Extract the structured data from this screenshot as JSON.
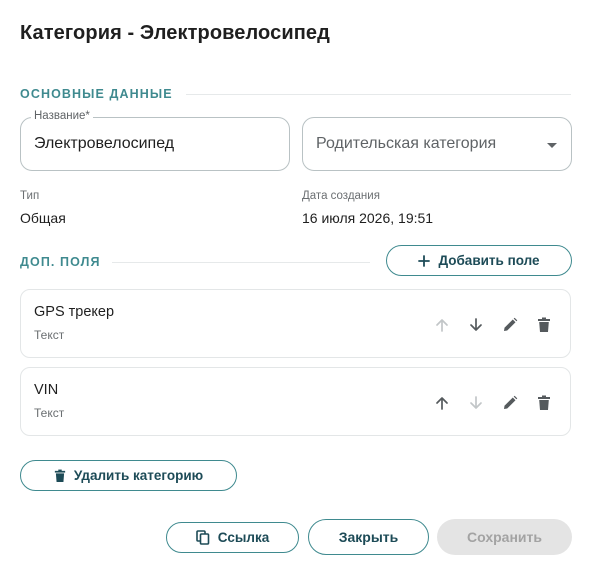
{
  "dialog": {
    "title": "Категория - Электровелосипед"
  },
  "basic_section": {
    "heading": "ОСНОВНЫЕ ДАННЫЕ"
  },
  "name_field": {
    "label": "Название*",
    "value": "Электровелосипед"
  },
  "parent_select": {
    "placeholder": "Родительская категория",
    "icon": "chevron-down-icon"
  },
  "type_info": {
    "label": "Тип",
    "value": "Общая"
  },
  "created_info": {
    "label": "Дата создания",
    "value": "16 июля 2026, 19:51"
  },
  "extra_section": {
    "heading": "ДОП. ПОЛЯ",
    "add_button_label": "Добавить поле"
  },
  "fields": [
    {
      "name": "GPS трекер",
      "type": "Текст",
      "can_move_up": false,
      "can_move_down": true
    },
    {
      "name": "VIN",
      "type": "Текст",
      "can_move_up": true,
      "can_move_down": false
    }
  ],
  "delete_category_button": {
    "label": "Удалить категорию"
  },
  "footer": {
    "link_button_label": "Ссылка",
    "close_button_label": "Закрыть",
    "save_button_label": "Сохранить",
    "save_enabled": false
  },
  "colors": {
    "accent": "#3f8a8f",
    "button_text": "#1d4b57",
    "icon_active": "#555a5d",
    "icon_disabled": "#c2c6c8"
  }
}
